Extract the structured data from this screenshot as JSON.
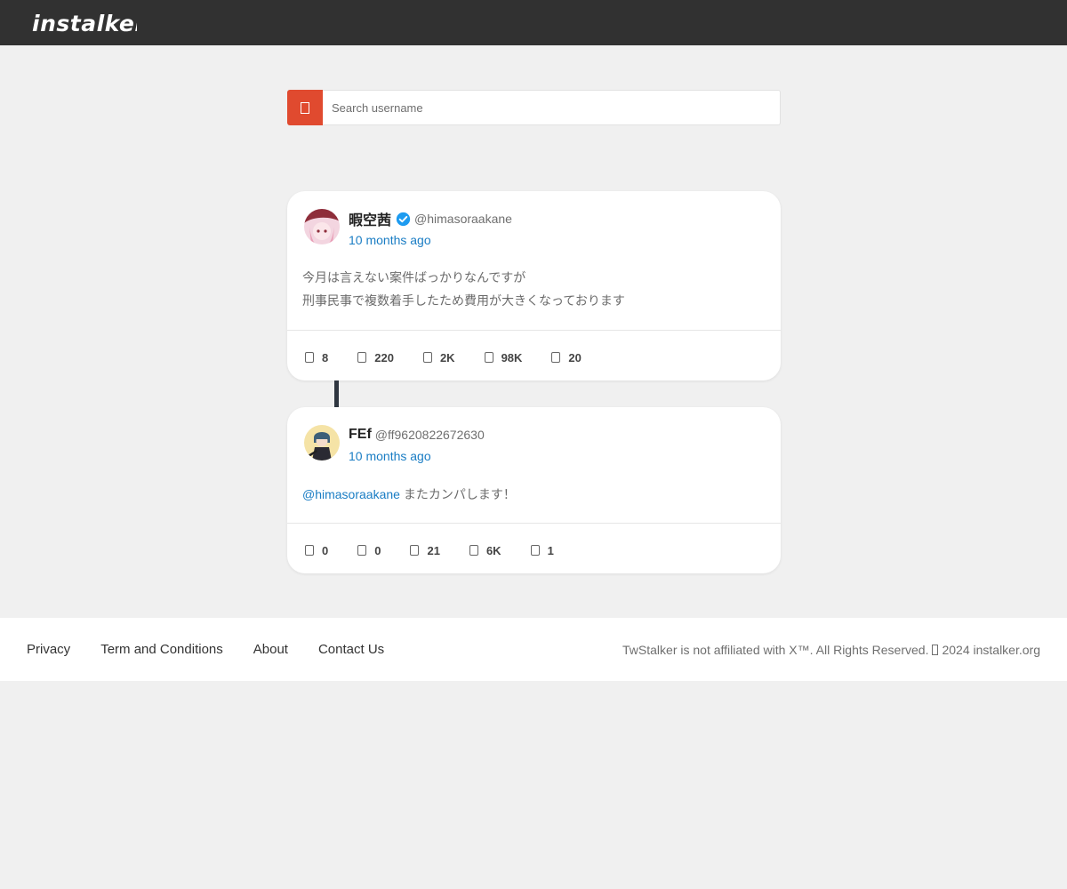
{
  "header": {
    "logo_text": "instalker",
    "brand_color": "#e8623f",
    "bar_color": "#313131"
  },
  "search": {
    "placeholder": "Search username",
    "button_icon": "search-icon",
    "button_color": "#e04a2f"
  },
  "tweets": [
    {
      "name": "暇空茜",
      "verified": true,
      "handle": "@himasoraakane",
      "time": "10 months ago",
      "lines": [
        "今月は言えない案件ばっかりなんですが",
        "刑事民事で複数着手したため費用が大きくなっております"
      ],
      "stats": [
        {
          "icon": "reply-icon",
          "value": "8"
        },
        {
          "icon": "retweet-icon",
          "value": "220"
        },
        {
          "icon": "like-icon",
          "value": "2K"
        },
        {
          "icon": "views-icon",
          "value": "98K"
        },
        {
          "icon": "bookmark-icon",
          "value": "20"
        }
      ]
    },
    {
      "name": "FEf",
      "verified": false,
      "handle": "@ff9620822672630",
      "time": "10 months ago",
      "mention": "@himasoraakane",
      "text": "またカンパします！",
      "stats": [
        {
          "icon": "reply-icon",
          "value": "0"
        },
        {
          "icon": "retweet-icon",
          "value": "0"
        },
        {
          "icon": "like-icon",
          "value": "21"
        },
        {
          "icon": "views-icon",
          "value": "6K"
        },
        {
          "icon": "bookmark-icon",
          "value": "1"
        }
      ]
    }
  ],
  "footer": {
    "links": [
      "Privacy",
      "Term and Conditions",
      "About",
      "Contact Us"
    ],
    "copyright_prefix": "TwStalker is not affiliated with X™. All Rights Reserved.",
    "copyright_suffix": "2024 instalker.org"
  }
}
